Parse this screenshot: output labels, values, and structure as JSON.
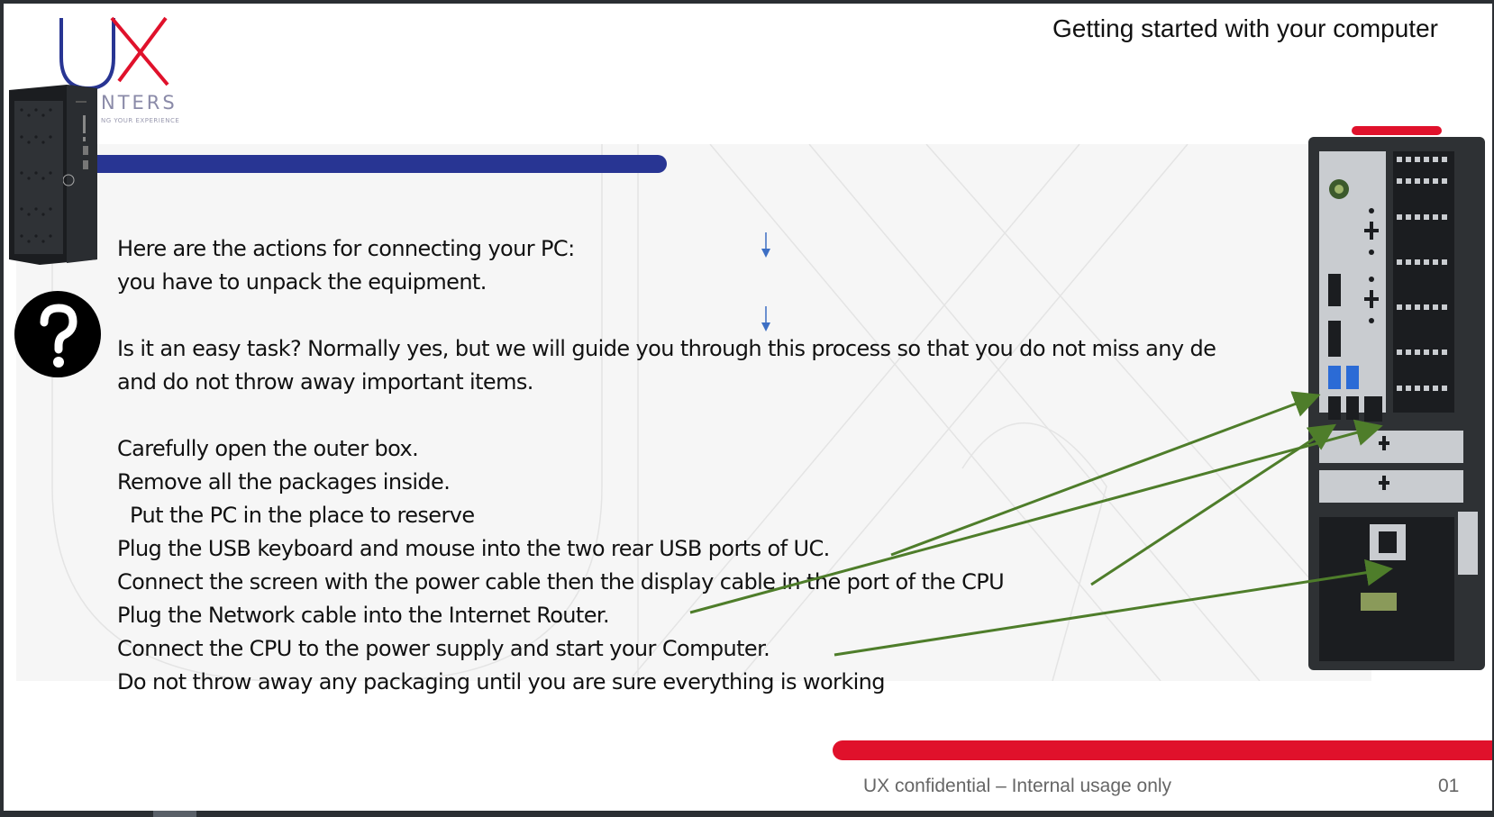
{
  "slide": {
    "title": "Getting started with your computer",
    "logo": {
      "text": "NTERS",
      "tagline": "NG YOUR EXPERIENCE",
      "colors": {
        "u": "#283593",
        "x": "#e0112b"
      }
    },
    "body_lines": [
      "Here are the actions for connecting your PC:",
      "you have to unpack the equipment.",
      "",
      "Is it an easy task? Normally yes, but we will guide you through this process so that you do not miss any de",
      "and do not throw away important items.",
      "",
      "Carefully open the outer box.",
      "Remove all the packages inside.",
      "  Put the PC in the place to reserve",
      "Plug the USB keyboard and mouse into the two rear USB ports of UC.",
      "Connect the screen with the power cable then the display cable in the port of the CPU",
      "Plug the Network cable into the Internet Router.",
      "Connect the CPU to the power supply and start your Computer.",
      "Do not throw away any packaging until you are sure everything is working"
    ],
    "footer": "UX confidential – Internal usage only",
    "page_number": "01",
    "icons": [
      "help-icon",
      "arrow-down-icon",
      "arrow-down-icon",
      "pc-tower-front-image",
      "pc-tower-rear-image"
    ],
    "colors": {
      "accent_blue": "#283593",
      "accent_red": "#e0112b",
      "connector_green": "#4e7d2a",
      "small_arrow_blue": "#3d6fc4"
    }
  }
}
